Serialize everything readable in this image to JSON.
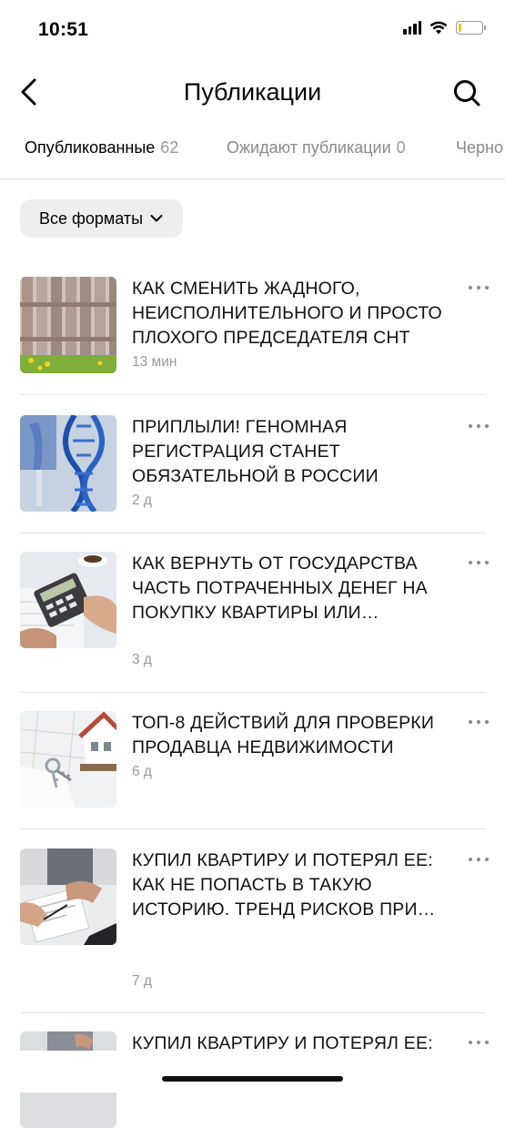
{
  "status_bar": {
    "time": "10:51"
  },
  "header": {
    "title": "Публикации"
  },
  "tabs": [
    {
      "label": "Опубликованные",
      "count": "62",
      "active": true
    },
    {
      "label": "Ожидают публикации",
      "count": "0",
      "active": false
    },
    {
      "label": "Черно",
      "count": "",
      "active": false
    }
  ],
  "filter": {
    "label": "Все форматы"
  },
  "articles": [
    {
      "title": "КАК СМЕНИТЬ ЖАДНОГО, НЕИСПОЛНИТЕЛЬНОГО И ПРОСТО ПЛОХОГО ПРЕДСЕДАТЕЛЯ СНТ",
      "age": "13 мин",
      "thumb": "fence-image"
    },
    {
      "title": "ПРИПЛЫЛИ! ГЕНОМНАЯ РЕГИСТРАЦИЯ СТАНЕТ ОБЯЗАТЕЛЬНОЙ В РОССИИ",
      "age": "2 д",
      "thumb": "dna-image"
    },
    {
      "title": "КАК ВЕРНУТЬ ОТ ГОСУДАРСТВА ЧАСТЬ ПОТРАЧЕННЫХ ДЕНЕГ НА ПОКУПКУ КВАРТИРЫ ИЛИ…",
      "age": "3 д",
      "thumb": "calculator-image"
    },
    {
      "title": "ТОП-8 ДЕЙСТВИЙ ДЛЯ ПРОВЕРКИ ПРОДАВЦА НЕДВИЖИМОСТИ",
      "age": "6 д",
      "thumb": "house-keys-image"
    },
    {
      "title": "КУПИЛ КВАРТИРУ И ПОТЕРЯЛ ЕЕ: КАК НЕ ПОПАСТЬ В ТАКУЮ ИСТОРИЮ. ТРЕНД РИСКОВ ПРИ…",
      "age": "7 д",
      "thumb": "contract-signing-image"
    },
    {
      "title": "КУПИЛ КВАРТИРУ И ПОТЕРЯЛ ЕЕ:",
      "age": "",
      "thumb": "contract-image"
    }
  ],
  "colors": {
    "text": "#111111",
    "muted": "#9a9a9a",
    "filter_bg": "#eeeeee",
    "divider": "#e4e4e4"
  }
}
